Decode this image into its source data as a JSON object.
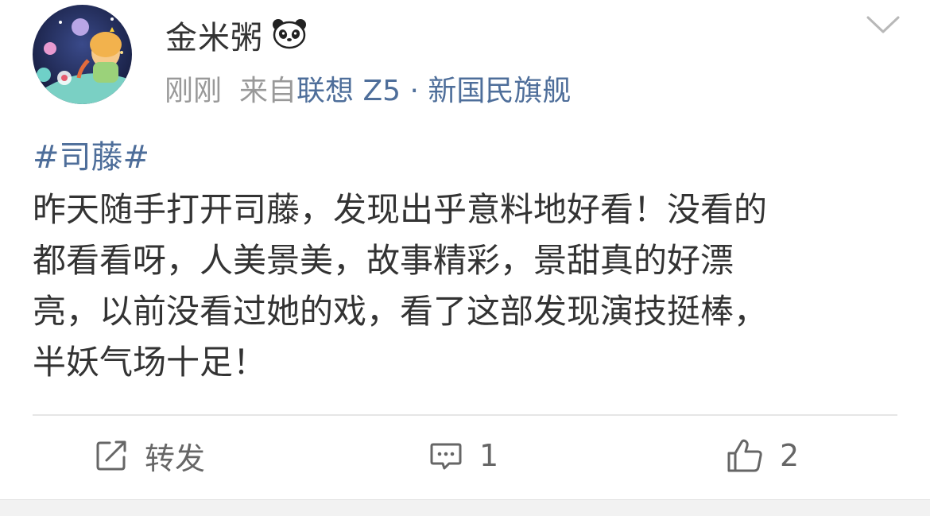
{
  "post": {
    "username": "金米粥",
    "time": "刚刚",
    "from_label": "来自",
    "device": "联想 Z5 · 新国民旗舰",
    "hashtag": "#司藤#",
    "content_lines": [
      "昨天随手打开司藤，发现出乎意料地好看！没看的",
      "都看看呀，人美景美，故事精彩，景甜真的好漂",
      "亮，以前没看过她的戏，看了这部发现演技挺棒，",
      "半妖气场十足！"
    ]
  },
  "actions": {
    "repost_label": "转发",
    "comment_count": "1",
    "like_count": "2"
  },
  "icons": {
    "avatar": "avatar-illustration",
    "badge": "panda-icon",
    "menu": "chevron-down-icon",
    "repost": "repost-icon",
    "comment": "comment-icon",
    "like": "thumbs-up-icon"
  },
  "colors": {
    "link": "#4e6e9a",
    "text": "#333333",
    "meta": "#999999",
    "action": "#666666"
  }
}
